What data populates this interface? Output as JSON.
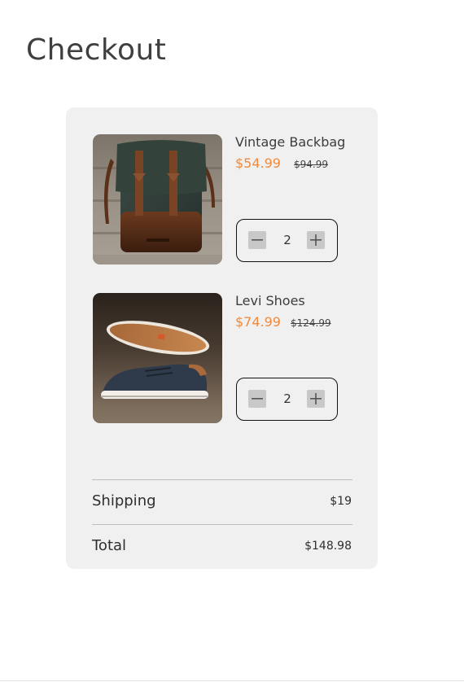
{
  "page": {
    "title": "Checkout"
  },
  "cart": {
    "items": [
      {
        "name": "Vintage Backbag",
        "sale_price": "$54.99",
        "original_price": "$94.99",
        "quantity": "2",
        "image_icon": "backpack-image"
      },
      {
        "name": "Levi Shoes",
        "sale_price": "$74.99",
        "original_price": "$124.99",
        "quantity": "2",
        "image_icon": "shoes-image"
      }
    ],
    "shipping_label": "Shipping",
    "shipping_value": "$19",
    "total_label": "Total",
    "total_value": "$148.98"
  },
  "colors": {
    "accent_price": "#f08a3c",
    "card_background": "#f0f0f0",
    "title_text": "#3f3f3f"
  }
}
